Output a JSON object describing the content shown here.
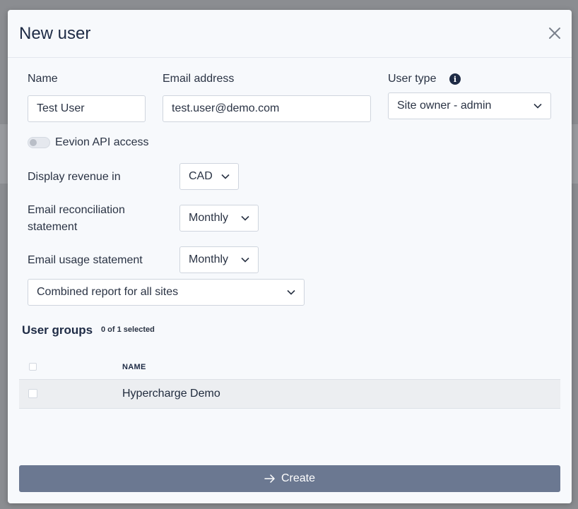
{
  "modal": {
    "title": "New user"
  },
  "form": {
    "name": {
      "label": "Name",
      "value": "Test User"
    },
    "email": {
      "label": "Email address",
      "value": "test.user@demo.com"
    },
    "user_type": {
      "label": "User type",
      "selected": "Site owner - admin"
    },
    "api_access": {
      "label": "Eevion API access",
      "enabled": false
    },
    "display_revenue": {
      "label": "Display revenue in",
      "selected": "CAD"
    },
    "reconciliation": {
      "label_line1": "Email reconciliation",
      "label_line2": "statement",
      "selected": "Monthly"
    },
    "usage": {
      "label": "Email usage statement",
      "selected": "Monthly"
    },
    "report_scope": {
      "selected": "Combined report for all sites"
    }
  },
  "user_groups": {
    "title": "User groups",
    "count": "0 of 1 selected",
    "column_name": "NAME",
    "rows": [
      {
        "name": "Hypercharge Demo"
      }
    ]
  },
  "actions": {
    "create_label": "Create"
  },
  "colors": {
    "primary_button": "#6b7891",
    "title": "#1e2b45"
  }
}
